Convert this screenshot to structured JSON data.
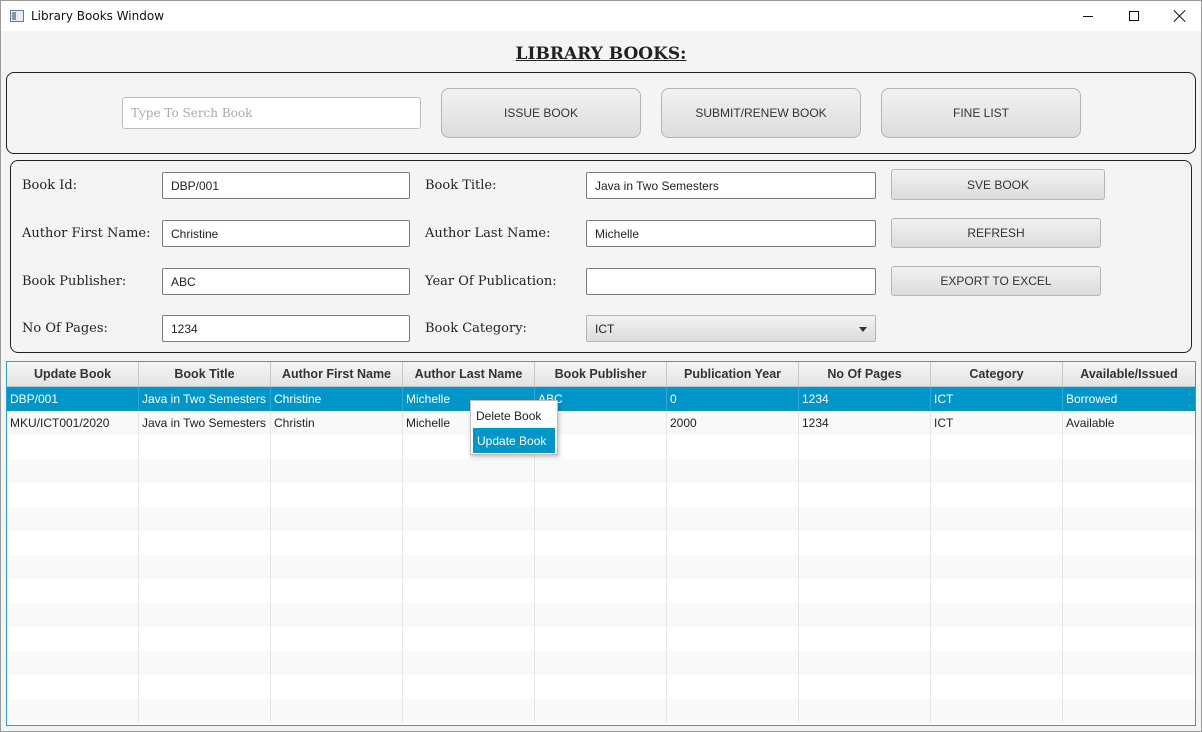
{
  "window": {
    "title": "Library Books Window"
  },
  "heading": "LIBRARY BOOKS:",
  "toolbar": {
    "search_placeholder": "Type To Serch Book",
    "search_value": "",
    "issue_label": "ISSUE BOOK",
    "submit_label": "SUBMIT/RENEW BOOK",
    "fine_label": "FINE LIST"
  },
  "form": {
    "book_id_label": "Book Id:",
    "book_id": "DBP/001",
    "book_title_label": "Book Title:",
    "book_title": "Java in Two Semesters",
    "author_first_label": "Author First Name:",
    "author_first": "Christine",
    "author_last_label": "Author Last Name:",
    "author_last": "Michelle",
    "publisher_label": "Book Publisher:",
    "publisher": "ABC",
    "pub_year_label": "Year Of Publication:",
    "pub_year": "",
    "pages_label": "No Of Pages:",
    "pages": "1234",
    "category_label": "Book Category:",
    "category": "ICT",
    "save_label": "SVE BOOK",
    "refresh_label": "REFRESH",
    "export_label": "EXPORT TO EXCEL"
  },
  "table": {
    "headers": [
      "Update Book",
      "Book Title",
      "Author First Name",
      "Author Last Name",
      "Book Publisher",
      "Publication Year",
      "No Of Pages",
      "Category",
      "Available/Issued"
    ],
    "rows": [
      [
        "DBP/001",
        "Java in Two Semesters",
        "Christine",
        "Michelle",
        "ABC",
        "0",
        "1234",
        "ICT",
        "Borrowed"
      ],
      [
        "MKU/ICT001/2020",
        "Java in Two Semesters",
        "Christin",
        "Michelle",
        "",
        "2000",
        "1234",
        "ICT",
        "Available"
      ]
    ],
    "selected_row": 0
  },
  "context_menu": {
    "items": [
      "Delete Book",
      "Update Book"
    ],
    "highlighted": 1
  },
  "colors": {
    "selection": "#0096c9",
    "table_border": "#2a9fd6"
  }
}
